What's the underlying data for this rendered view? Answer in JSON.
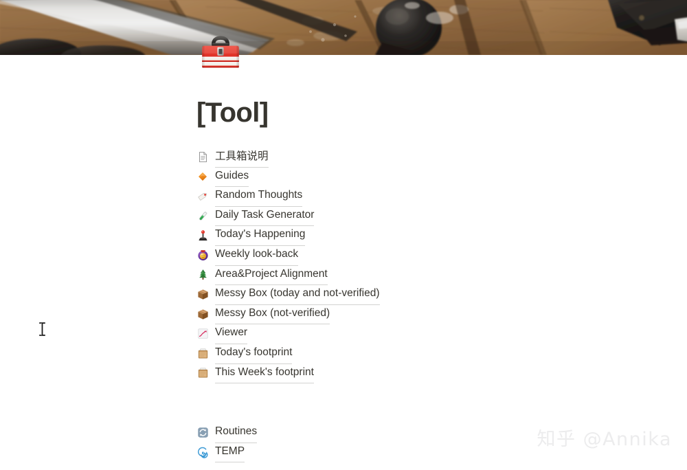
{
  "page": {
    "title": "[Tool]",
    "icon": "toolbox-emoji",
    "cover_image": "tools-on-wooden-table-photo"
  },
  "links": [
    {
      "icon": "page-document-icon",
      "label": "工具箱说明",
      "cjk": true
    },
    {
      "icon": "orange-diamond-icon",
      "label": "Guides"
    },
    {
      "icon": "label-tag-icon",
      "label": "Random Thoughts"
    },
    {
      "icon": "test-tube-icon",
      "label": "Daily Task Generator"
    },
    {
      "icon": "joystick-icon",
      "label": "Today's Happening"
    },
    {
      "icon": "crystal-ball-icon",
      "label": "Weekly look-back"
    },
    {
      "icon": "evergreen-tree-icon",
      "label": "Area&Project Alignment"
    },
    {
      "icon": "package-box-icon",
      "label": "Messy Box (today and not-verified)"
    },
    {
      "icon": "package-box-icon",
      "label": "Messy Box (not-verified)"
    },
    {
      "icon": "chart-increasing-icon",
      "label": "Viewer"
    },
    {
      "icon": "card-index-box-icon",
      "label": "Today's footprint"
    },
    {
      "icon": "card-index-box-icon",
      "label": "This Week's footprint"
    },
    {
      "icon": "spacer",
      "label": ""
    },
    {
      "icon": "sync-arrows-icon",
      "label": "Routines"
    },
    {
      "icon": "cyclone-spiral-icon",
      "label": "TEMP"
    }
  ],
  "watermark": {
    "text": "知乎 @Annika"
  },
  "colors": {
    "text": "#37352f",
    "background": "#ffffff",
    "watermark": "#ececed",
    "underline": "rgba(55,53,47,0.22)"
  }
}
